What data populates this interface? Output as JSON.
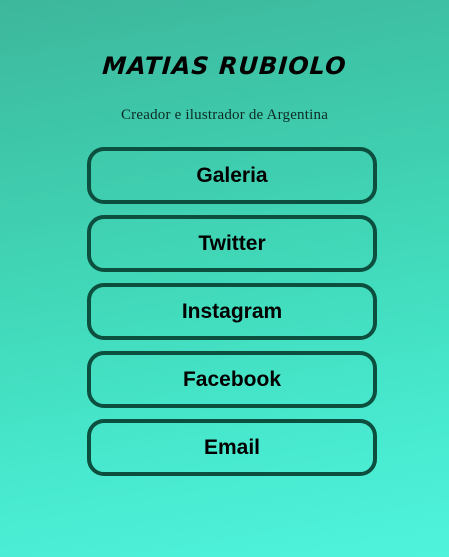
{
  "profile": {
    "name": "MATIAS RUBIOLO",
    "tagline": "Creador e ilustrador de Argentina"
  },
  "links": [
    {
      "label": "Galeria"
    },
    {
      "label": "Twitter"
    },
    {
      "label": "Instagram"
    },
    {
      "label": "Facebook"
    },
    {
      "label": "Email"
    }
  ],
  "colors": {
    "background_top": "#3db79c",
    "background_bottom": "#4ff3dc",
    "button_border": "#0c4f3f",
    "text": "#000000"
  }
}
